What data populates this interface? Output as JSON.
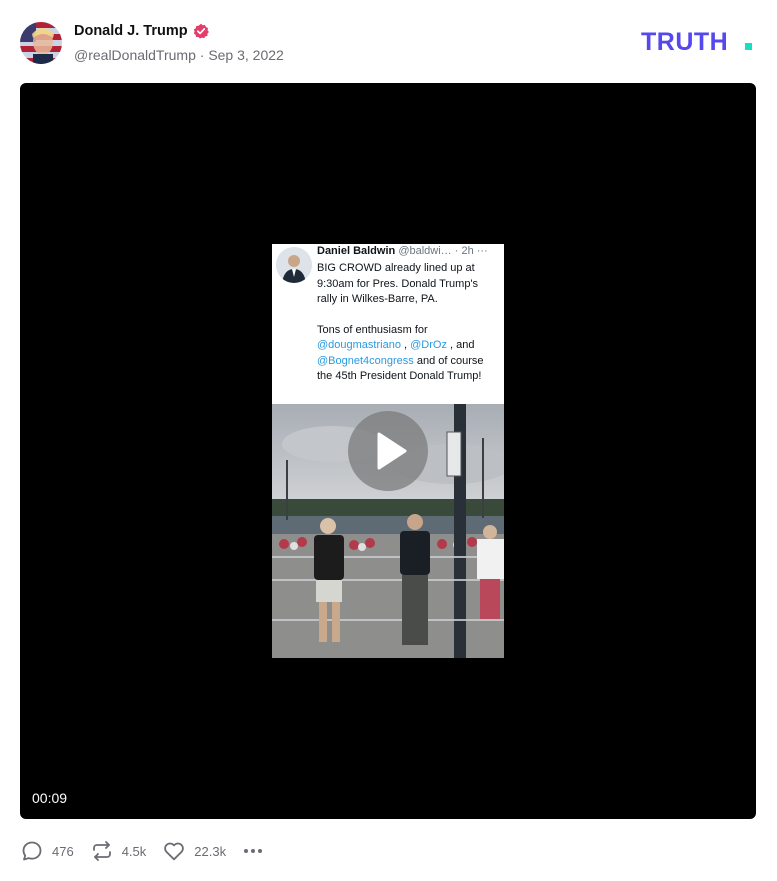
{
  "post": {
    "author_name": "Donald J. Trump",
    "handle": "@realDonaldTrump",
    "separator": "·",
    "date": "Sep 3, 2022",
    "verified_icon": "verified-badge-icon",
    "brand_logo_text": "TRUTH."
  },
  "colors": {
    "brand_purple": "#5448ee",
    "brand_teal": "#17e0c0",
    "verified": "#e23d6b",
    "muted": "#6b6b73",
    "video_bg": "#000000"
  },
  "video": {
    "duration": "00:09",
    "play_icon": "play-icon",
    "embedded_tweet": {
      "author": "Daniel Baldwin",
      "handle": "@baldwi…",
      "time": "· 2h",
      "menu": "···",
      "line1": "BIG CROWD already lined up at 9:30am for Pres. Donald Trump's rally in Wilkes-Barre, PA.",
      "line2_prefix": "Tons of enthusiasm for ",
      "mention1": "@dougmastriano",
      "sep1": " , ",
      "mention2": "@DrOz",
      "sep2": " , and ",
      "mention3": "@Bognet4congress",
      "line2_suffix": " and of course the 45th President Donald Trump!"
    }
  },
  "actions": {
    "replies": {
      "icon": "reply-icon",
      "count": "476"
    },
    "retruths": {
      "icon": "retruth-icon",
      "count": "4.5k"
    },
    "likes": {
      "icon": "heart-icon",
      "count": "22.3k"
    },
    "more": {
      "icon": "more-icon"
    }
  }
}
